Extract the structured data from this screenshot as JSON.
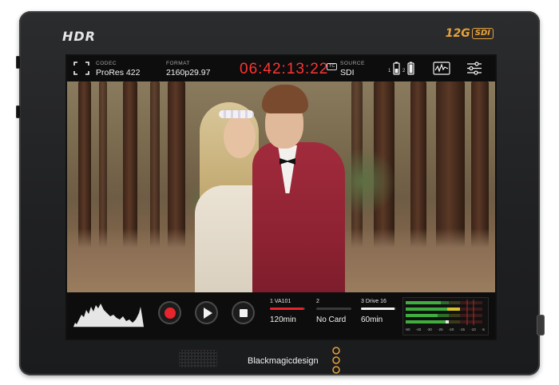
{
  "device": {
    "hdr_label": "HDR",
    "sdi_badge": {
      "number": "12G",
      "text": "SDI"
    },
    "brand_name": "Blackmagicdesign",
    "brand_color": "#e8a23a"
  },
  "top_bar": {
    "codec": {
      "label": "CODEC",
      "value": "ProRes 422"
    },
    "format": {
      "label": "FORMAT",
      "value": "2160p29.97"
    },
    "timecode": "06:42:13:22",
    "timecode_color": "#ff3333",
    "tc_badge": "TC",
    "source": {
      "label": "SOURCE",
      "value": "SDI"
    },
    "battery": {
      "slot1": "1",
      "slot2": "2"
    },
    "icons": [
      "focus-frame-icon",
      "battery-icon",
      "waveform-scope-icon",
      "settings-sliders-icon"
    ]
  },
  "bottom_bar": {
    "transport": [
      "record-button",
      "play-button",
      "stop-button"
    ],
    "record_color": "#e8242c",
    "cards": [
      {
        "name": "1  VA101",
        "time": "120min",
        "fill": 0.95,
        "color": "#e8242c"
      },
      {
        "name": "2",
        "time": "No Card",
        "fill": 0.0,
        "color": "#777777"
      },
      {
        "name": "3  Drive 16",
        "time": "60min",
        "fill": 0.95,
        "color": "#f2f2f2"
      }
    ],
    "meter_scale": [
      "-50",
      "-40",
      "-30",
      "-25",
      "-20",
      "-15",
      "-10",
      "-5"
    ]
  }
}
